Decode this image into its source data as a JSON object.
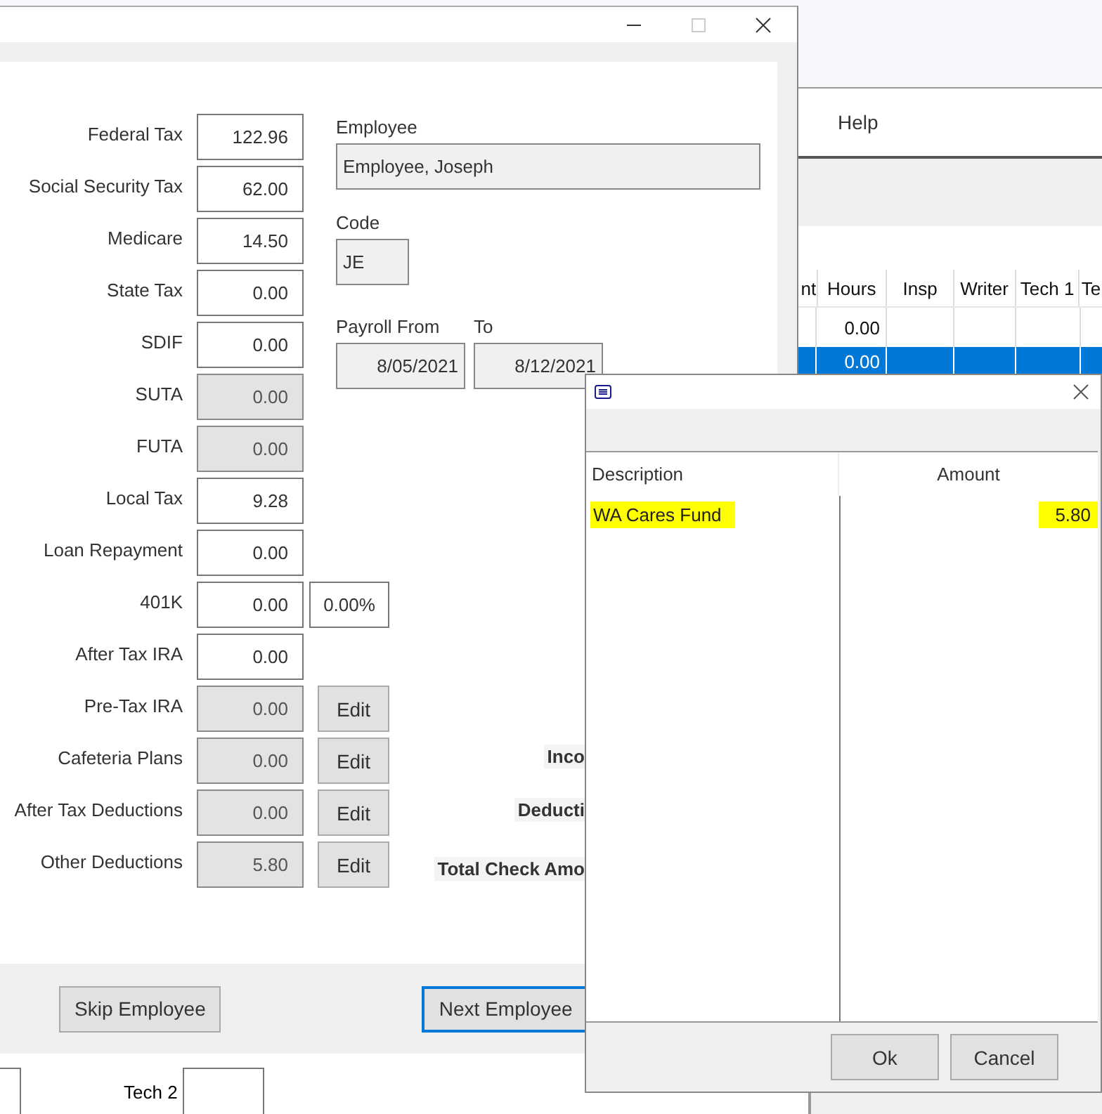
{
  "background_app": {
    "menu": [
      {
        "label": "Help"
      }
    ],
    "grid": {
      "columns": [
        "nt",
        "Hours",
        "Insp",
        "Writer",
        "Tech 1",
        "Te"
      ],
      "rows": [
        {
          "selected": false,
          "cells": [
            "",
            "0.00",
            "",
            "",
            "",
            ""
          ]
        },
        {
          "selected": true,
          "cells": [
            "",
            "0.00",
            "",
            "",
            "",
            ""
          ]
        }
      ]
    },
    "footer_label": "Tech 2"
  },
  "payroll_window": {
    "deductions": [
      {
        "label": "Federal Tax",
        "value": "122.96",
        "disabled": false
      },
      {
        "label": "Social Security Tax",
        "value": "62.00",
        "disabled": false
      },
      {
        "label": "Medicare",
        "value": "14.50",
        "disabled": false
      },
      {
        "label": "State Tax",
        "value": "0.00",
        "disabled": false
      },
      {
        "label": "SDIF",
        "value": "0.00",
        "disabled": false
      },
      {
        "label": "SUTA",
        "value": "0.00",
        "disabled": true
      },
      {
        "label": "FUTA",
        "value": "0.00",
        "disabled": true
      },
      {
        "label": "Local Tax",
        "value": "9.28",
        "disabled": false
      },
      {
        "label": "Loan Repayment",
        "value": "0.00",
        "disabled": false
      },
      {
        "label": "401K",
        "value": "0.00",
        "disabled": false,
        "percent": "0.00%"
      },
      {
        "label": "After Tax IRA",
        "value": "0.00",
        "disabled": false
      },
      {
        "label": "Pre-Tax IRA",
        "value": "0.00",
        "disabled": true,
        "edit": "Edit"
      },
      {
        "label": "Cafeteria Plans",
        "value": "0.00",
        "disabled": true,
        "edit": "Edit"
      },
      {
        "label": "After Tax Deductions",
        "value": "0.00",
        "disabled": true,
        "edit": "Edit"
      },
      {
        "label": "Other Deductions",
        "value": "5.80",
        "disabled": true,
        "edit": "Edit"
      }
    ],
    "employee": {
      "label": "Employee",
      "value": "Employee, Joseph"
    },
    "code": {
      "label": "Code",
      "value": "JE"
    },
    "payroll_from": {
      "label": "Payroll From",
      "value": "8/05/2021"
    },
    "payroll_to": {
      "label": "To",
      "value": "8/12/2021"
    },
    "totals": [
      "Inco",
      "Deducti",
      "Total Check Amo"
    ],
    "buttons": [
      {
        "label": "Skip Employee",
        "focused": false
      },
      {
        "label": "Next Employee",
        "focused": true
      }
    ]
  },
  "dialog": {
    "columns": [
      "Description",
      "Amount"
    ],
    "rows": [
      {
        "description": "WA Cares Fund",
        "amount": "5.80",
        "highlighted": true
      }
    ],
    "buttons": [
      "Ok",
      "Cancel"
    ]
  }
}
